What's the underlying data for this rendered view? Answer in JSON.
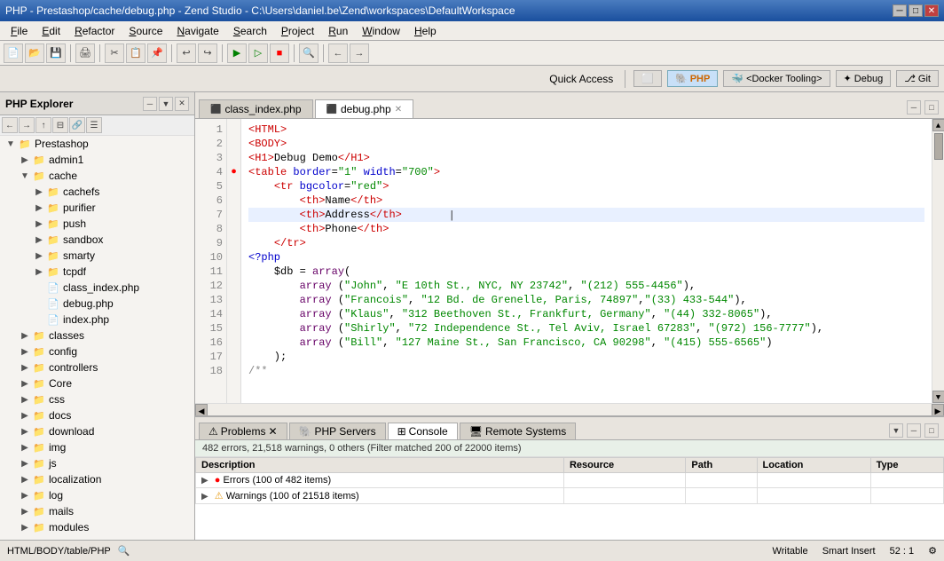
{
  "titleBar": {
    "title": "PHP - Prestashop/cache/debug.php - Zend Studio - C:\\Users\\daniel.be\\Zend\\workspaces\\DefaultWorkspace",
    "minimize": "─",
    "maximize": "□",
    "close": "✕"
  },
  "menu": {
    "items": [
      "File",
      "Edit",
      "Refactor",
      "Source",
      "Navigate",
      "Search",
      "Project",
      "Run",
      "Window",
      "Help"
    ]
  },
  "header": {
    "quickAccess": "Quick Access",
    "buttons": [
      "PHP",
      "< Docker Tooling >",
      "✦ Debug",
      "Git"
    ]
  },
  "sidebar": {
    "title": "PHP Explorer",
    "tree": [
      {
        "label": "admin1",
        "type": "folder",
        "indent": 2,
        "expand": true
      },
      {
        "label": "cache",
        "type": "folder",
        "indent": 2,
        "expand": true
      },
      {
        "label": "cachefs",
        "type": "folder",
        "indent": 4,
        "expand": false
      },
      {
        "label": "purifier",
        "type": "folder",
        "indent": 4,
        "expand": false
      },
      {
        "label": "push",
        "type": "folder",
        "indent": 4,
        "expand": false
      },
      {
        "label": "sandbox",
        "type": "folder",
        "indent": 4,
        "expand": false
      },
      {
        "label": "smarty",
        "type": "folder",
        "indent": 4,
        "expand": false
      },
      {
        "label": "tcpdf",
        "type": "folder",
        "indent": 4,
        "expand": false
      },
      {
        "label": "class_index.php",
        "type": "file",
        "indent": 4
      },
      {
        "label": "debug.php",
        "type": "file",
        "indent": 4
      },
      {
        "label": "index.php",
        "type": "file",
        "indent": 4
      },
      {
        "label": "classes",
        "type": "folder",
        "indent": 2,
        "expand": false
      },
      {
        "label": "config",
        "type": "folder",
        "indent": 2,
        "expand": false
      },
      {
        "label": "controllers",
        "type": "folder",
        "indent": 2,
        "expand": false
      },
      {
        "label": "Core",
        "type": "folder",
        "indent": 2,
        "expand": false
      },
      {
        "label": "css",
        "type": "folder",
        "indent": 2,
        "expand": false
      },
      {
        "label": "docs",
        "type": "folder",
        "indent": 2,
        "expand": false
      },
      {
        "label": "download",
        "type": "folder",
        "indent": 2,
        "expand": false
      },
      {
        "label": "img",
        "type": "folder",
        "indent": 2,
        "expand": false
      },
      {
        "label": "js",
        "type": "folder",
        "indent": 2,
        "expand": false
      },
      {
        "label": "localization",
        "type": "folder",
        "indent": 2,
        "expand": false
      },
      {
        "label": "log",
        "type": "folder",
        "indent": 2,
        "expand": false
      },
      {
        "label": "mails",
        "type": "folder",
        "indent": 2,
        "expand": false
      },
      {
        "label": "modules",
        "type": "folder",
        "indent": 2,
        "expand": false
      }
    ]
  },
  "editor": {
    "tabs": [
      {
        "label": "class_index.php",
        "active": false,
        "closable": false
      },
      {
        "label": "debug.php",
        "active": true,
        "closable": true
      }
    ],
    "code": [
      {
        "num": 1,
        "content": "<HTML>",
        "type": "html"
      },
      {
        "num": 2,
        "content": "<BODY>",
        "type": "html"
      },
      {
        "num": 3,
        "content": "<H1>Debug Demo</H1>",
        "type": "html"
      },
      {
        "num": 4,
        "content": "<table border=\"1\" width=\"700\">",
        "type": "html",
        "error": true
      },
      {
        "num": 5,
        "content": "    <tr bgcolor=\"red\">",
        "type": "html"
      },
      {
        "num": 6,
        "content": "        <th>Name</th>",
        "type": "html"
      },
      {
        "num": 7,
        "content": "        <th>Address</th>",
        "type": "html"
      },
      {
        "num": 8,
        "content": "        <th>Phone</th>",
        "type": "html"
      },
      {
        "num": 9,
        "content": "    </tr>",
        "type": "html"
      },
      {
        "num": 10,
        "content": "<?php",
        "type": "php"
      },
      {
        "num": 11,
        "content": "    $db = array(",
        "type": "php"
      },
      {
        "num": 12,
        "content": "        array (\"John\", \"E 10th St., NYC, NY 23742\", \"(212) 555-4456\"),",
        "type": "php"
      },
      {
        "num": 13,
        "content": "        array (\"Francois\", \"12 Bd. de Grenelle, Paris, 74897\",\"(33) 433-544\"),",
        "type": "php"
      },
      {
        "num": 14,
        "content": "        array (\"Klaus\", \"312 Beethoven St., Frankfurt, Germany\", \"(44) 332-8065\"),",
        "type": "php"
      },
      {
        "num": 15,
        "content": "        array (\"Shirly\", \"72 Independence St., Tel Aviv, Israel 67283\", \"(972) 156-7777\"),",
        "type": "php"
      },
      {
        "num": 16,
        "content": "        array (\"Bill\", \"127 Maine St., San Francisco, CA 90298\", \"(415) 555-6565\")",
        "type": "php"
      },
      {
        "num": 17,
        "content": "    );",
        "type": "php"
      },
      {
        "num": 18,
        "content": "/**",
        "type": "comment"
      }
    ],
    "cursorLine": 7
  },
  "bottomPanel": {
    "tabs": [
      "Problems",
      "PHP Servers",
      "Console",
      "Remote Systems"
    ],
    "activeTab": "Console",
    "summary": "482 errors, 21,518 warnings, 0 others (Filter matched 200 of 22000 items)",
    "columns": [
      "Description",
      "Resource",
      "Path",
      "Location",
      "Type"
    ],
    "rows": [
      {
        "type": "error",
        "label": "Errors (100 of 482 items)",
        "resource": "",
        "path": "",
        "location": "",
        "rowtype": ""
      },
      {
        "type": "warning",
        "label": "Warnings (100 of 21518 items)",
        "resource": "",
        "path": "",
        "location": "",
        "rowtype": ""
      }
    ]
  },
  "statusBar": {
    "breadcrumb": "HTML/BODY/table/PHP",
    "writeMode": "Writable",
    "insertMode": "Smart Insert",
    "position": "52 : 1"
  }
}
